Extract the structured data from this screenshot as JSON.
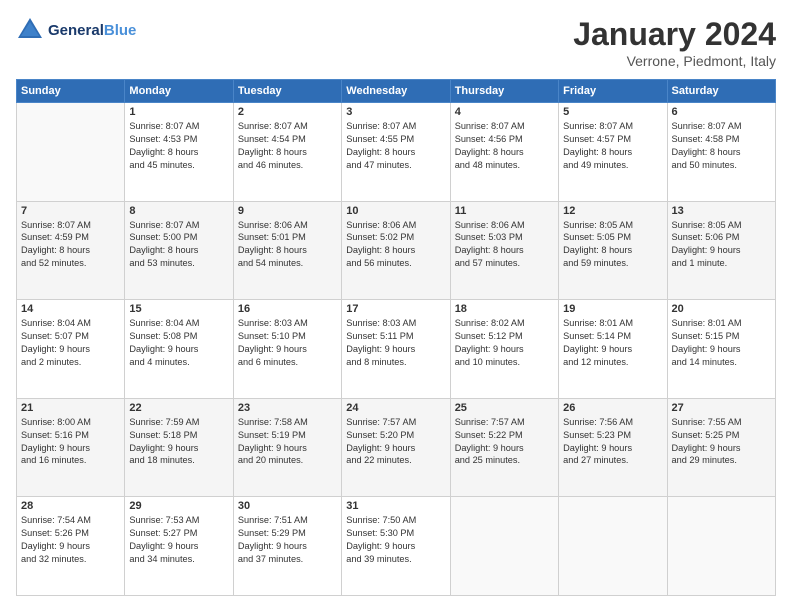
{
  "header": {
    "logo_line1": "General",
    "logo_line2": "Blue",
    "month": "January 2024",
    "location": "Verrone, Piedmont, Italy"
  },
  "weekdays": [
    "Sunday",
    "Monday",
    "Tuesday",
    "Wednesday",
    "Thursday",
    "Friday",
    "Saturday"
  ],
  "weeks": [
    [
      {
        "day": "",
        "info": ""
      },
      {
        "day": "1",
        "info": "Sunrise: 8:07 AM\nSunset: 4:53 PM\nDaylight: 8 hours\nand 45 minutes."
      },
      {
        "day": "2",
        "info": "Sunrise: 8:07 AM\nSunset: 4:54 PM\nDaylight: 8 hours\nand 46 minutes."
      },
      {
        "day": "3",
        "info": "Sunrise: 8:07 AM\nSunset: 4:55 PM\nDaylight: 8 hours\nand 47 minutes."
      },
      {
        "day": "4",
        "info": "Sunrise: 8:07 AM\nSunset: 4:56 PM\nDaylight: 8 hours\nand 48 minutes."
      },
      {
        "day": "5",
        "info": "Sunrise: 8:07 AM\nSunset: 4:57 PM\nDaylight: 8 hours\nand 49 minutes."
      },
      {
        "day": "6",
        "info": "Sunrise: 8:07 AM\nSunset: 4:58 PM\nDaylight: 8 hours\nand 50 minutes."
      }
    ],
    [
      {
        "day": "7",
        "info": "Sunrise: 8:07 AM\nSunset: 4:59 PM\nDaylight: 8 hours\nand 52 minutes."
      },
      {
        "day": "8",
        "info": "Sunrise: 8:07 AM\nSunset: 5:00 PM\nDaylight: 8 hours\nand 53 minutes."
      },
      {
        "day": "9",
        "info": "Sunrise: 8:06 AM\nSunset: 5:01 PM\nDaylight: 8 hours\nand 54 minutes."
      },
      {
        "day": "10",
        "info": "Sunrise: 8:06 AM\nSunset: 5:02 PM\nDaylight: 8 hours\nand 56 minutes."
      },
      {
        "day": "11",
        "info": "Sunrise: 8:06 AM\nSunset: 5:03 PM\nDaylight: 8 hours\nand 57 minutes."
      },
      {
        "day": "12",
        "info": "Sunrise: 8:05 AM\nSunset: 5:05 PM\nDaylight: 8 hours\nand 59 minutes."
      },
      {
        "day": "13",
        "info": "Sunrise: 8:05 AM\nSunset: 5:06 PM\nDaylight: 9 hours\nand 1 minute."
      }
    ],
    [
      {
        "day": "14",
        "info": "Sunrise: 8:04 AM\nSunset: 5:07 PM\nDaylight: 9 hours\nand 2 minutes."
      },
      {
        "day": "15",
        "info": "Sunrise: 8:04 AM\nSunset: 5:08 PM\nDaylight: 9 hours\nand 4 minutes."
      },
      {
        "day": "16",
        "info": "Sunrise: 8:03 AM\nSunset: 5:10 PM\nDaylight: 9 hours\nand 6 minutes."
      },
      {
        "day": "17",
        "info": "Sunrise: 8:03 AM\nSunset: 5:11 PM\nDaylight: 9 hours\nand 8 minutes."
      },
      {
        "day": "18",
        "info": "Sunrise: 8:02 AM\nSunset: 5:12 PM\nDaylight: 9 hours\nand 10 minutes."
      },
      {
        "day": "19",
        "info": "Sunrise: 8:01 AM\nSunset: 5:14 PM\nDaylight: 9 hours\nand 12 minutes."
      },
      {
        "day": "20",
        "info": "Sunrise: 8:01 AM\nSunset: 5:15 PM\nDaylight: 9 hours\nand 14 minutes."
      }
    ],
    [
      {
        "day": "21",
        "info": "Sunrise: 8:00 AM\nSunset: 5:16 PM\nDaylight: 9 hours\nand 16 minutes."
      },
      {
        "day": "22",
        "info": "Sunrise: 7:59 AM\nSunset: 5:18 PM\nDaylight: 9 hours\nand 18 minutes."
      },
      {
        "day": "23",
        "info": "Sunrise: 7:58 AM\nSunset: 5:19 PM\nDaylight: 9 hours\nand 20 minutes."
      },
      {
        "day": "24",
        "info": "Sunrise: 7:57 AM\nSunset: 5:20 PM\nDaylight: 9 hours\nand 22 minutes."
      },
      {
        "day": "25",
        "info": "Sunrise: 7:57 AM\nSunset: 5:22 PM\nDaylight: 9 hours\nand 25 minutes."
      },
      {
        "day": "26",
        "info": "Sunrise: 7:56 AM\nSunset: 5:23 PM\nDaylight: 9 hours\nand 27 minutes."
      },
      {
        "day": "27",
        "info": "Sunrise: 7:55 AM\nSunset: 5:25 PM\nDaylight: 9 hours\nand 29 minutes."
      }
    ],
    [
      {
        "day": "28",
        "info": "Sunrise: 7:54 AM\nSunset: 5:26 PM\nDaylight: 9 hours\nand 32 minutes."
      },
      {
        "day": "29",
        "info": "Sunrise: 7:53 AM\nSunset: 5:27 PM\nDaylight: 9 hours\nand 34 minutes."
      },
      {
        "day": "30",
        "info": "Sunrise: 7:51 AM\nSunset: 5:29 PM\nDaylight: 9 hours\nand 37 minutes."
      },
      {
        "day": "31",
        "info": "Sunrise: 7:50 AM\nSunset: 5:30 PM\nDaylight: 9 hours\nand 39 minutes."
      },
      {
        "day": "",
        "info": ""
      },
      {
        "day": "",
        "info": ""
      },
      {
        "day": "",
        "info": ""
      }
    ]
  ]
}
